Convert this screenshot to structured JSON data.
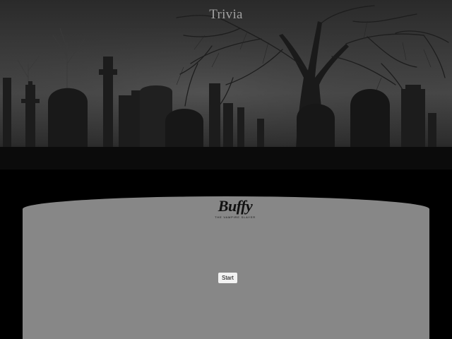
{
  "header": {
    "title": "Trivia"
  },
  "logo": {
    "title": "Buffy",
    "subtitle": "THE VAMPIRE SLAYER"
  },
  "quiz": {
    "start_label": "Start"
  },
  "colors": {
    "background": "#000000",
    "panel": "#878787",
    "button": "#f2f2f2",
    "title_text": "#a0a0a0"
  }
}
